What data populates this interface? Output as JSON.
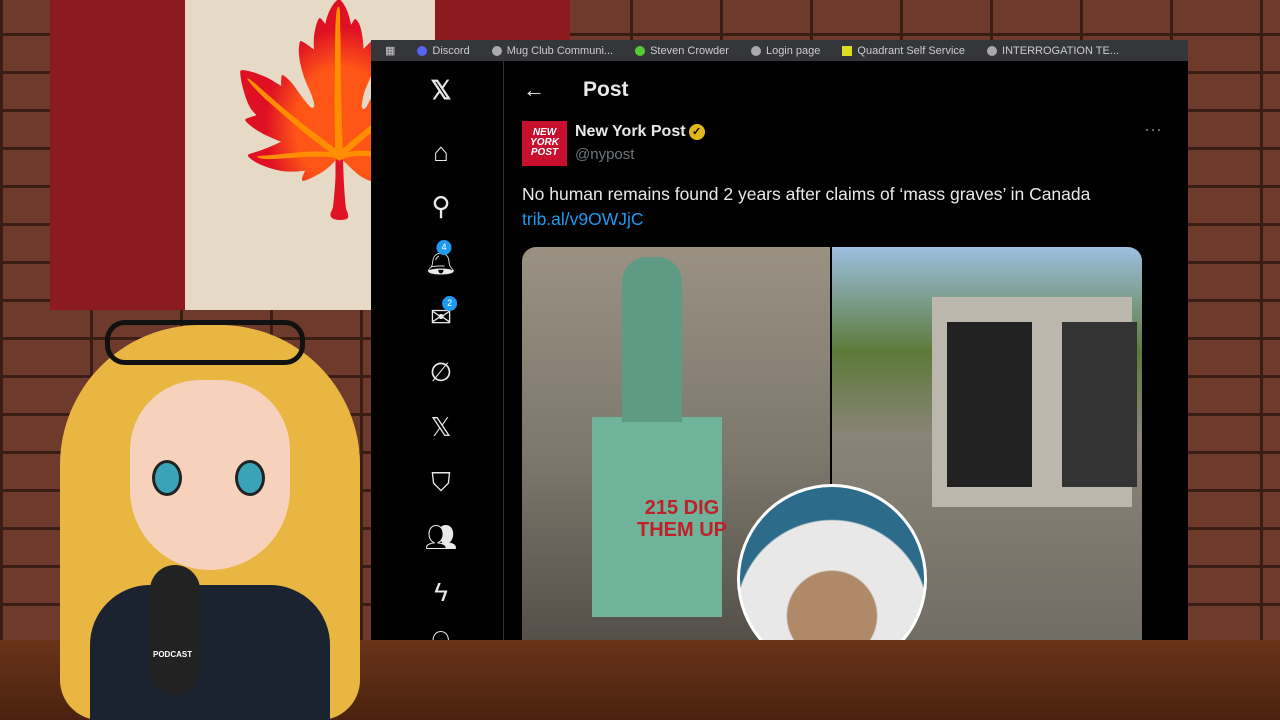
{
  "bookmarks": [
    "Discord",
    "Mug Club Communi...",
    "Steven Crowder",
    "Login page",
    "Quadrant Self Service",
    "INTERROGATION TE..."
  ],
  "nav": {
    "notifications_badge": "4",
    "messages_badge": "2"
  },
  "header": {
    "title": "Post"
  },
  "post": {
    "author": "New York Post",
    "avatar_text": "NEW YORK POST",
    "handle": "@nypost",
    "text": "No human remains found 2 years after claims of ‘mass graves’ in Canada",
    "link": "trib.al/v9OWJjC",
    "image_text": "215 DIG THEM UP"
  },
  "overlay": {
    "mic_label": "PODCAST"
  },
  "colors": {
    "accent": "#1d9bf0",
    "verified": "#e2b719",
    "background": "#000000"
  }
}
